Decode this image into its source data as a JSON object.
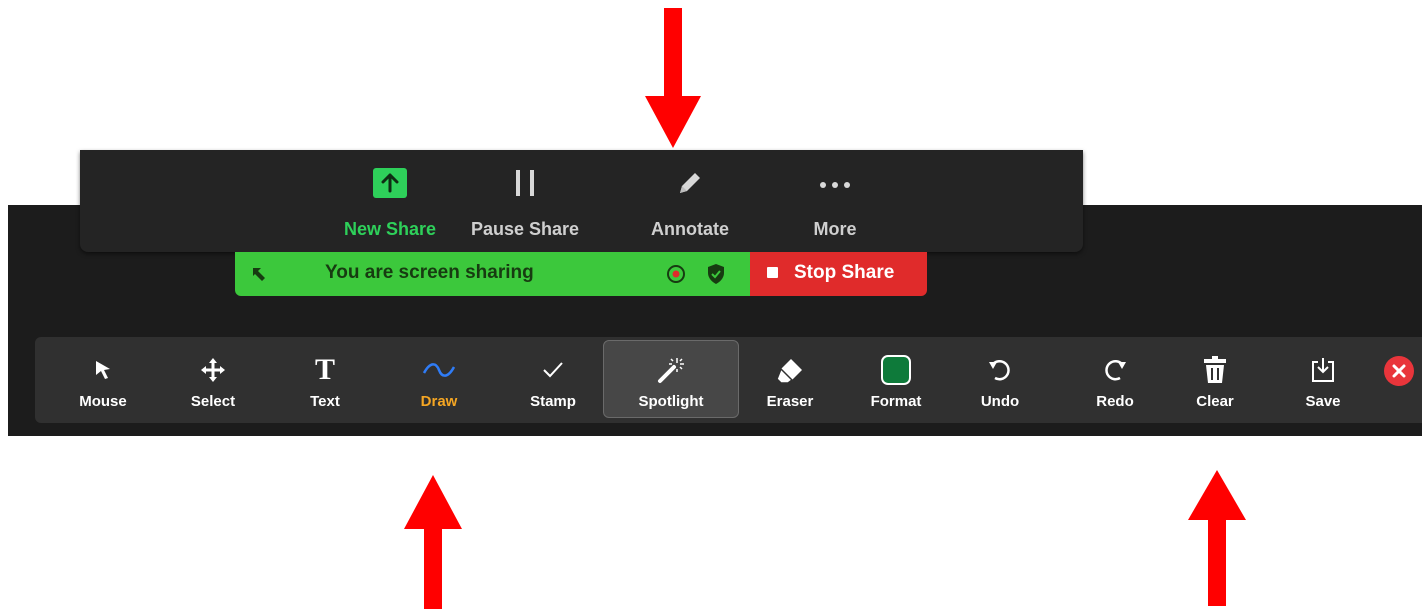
{
  "share_toolbar": {
    "new_share": "New Share",
    "pause_share": "Pause Share",
    "annotate": "Annotate",
    "more": "More"
  },
  "status_bar": {
    "message": "You are screen sharing",
    "stop_share": "Stop Share"
  },
  "annotation_toolbar": {
    "mouse": "Mouse",
    "select": "Select",
    "text": "Text",
    "draw": "Draw",
    "stamp": "Stamp",
    "spotlight": "Spotlight",
    "eraser": "Eraser",
    "format": "Format",
    "undo": "Undo",
    "redo": "Redo",
    "clear": "Clear",
    "save": "Save"
  },
  "colors": {
    "accent_green": "#2ed05a",
    "status_green": "#3cc83c",
    "stop_red": "#e02b2b",
    "draw_orange": "#f5a623",
    "format_swatch": "#0e7a3a",
    "arrow_red": "#ff0000"
  },
  "icons": [
    "up-arrow-icon",
    "pause-icon",
    "pencil-icon",
    "ellipsis-icon",
    "back-arrow-icon",
    "record-icon",
    "shield-icon",
    "stop-icon",
    "cursor-icon",
    "move-icon",
    "text-icon",
    "wave-icon",
    "checkmark-icon",
    "wand-icon",
    "eraser-icon",
    "color-swatch-icon",
    "undo-icon",
    "redo-icon",
    "trash-icon",
    "download-icon",
    "close-icon"
  ]
}
